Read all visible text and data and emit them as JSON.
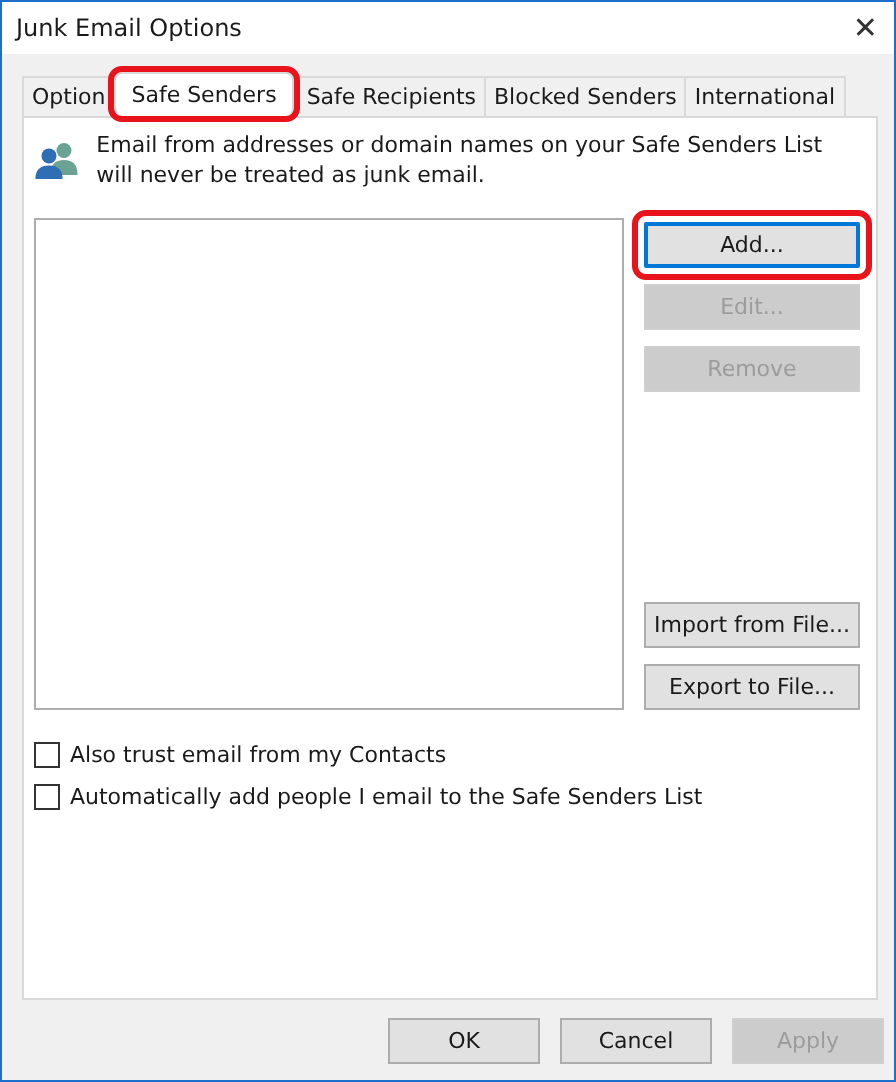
{
  "window": {
    "title": "Junk Email Options",
    "close": "✕"
  },
  "tabs": [
    {
      "label": "Option",
      "selected": false,
      "highlighted": false
    },
    {
      "label": "Safe Senders",
      "selected": true,
      "highlighted": true
    },
    {
      "label": "Safe Recipients",
      "selected": false,
      "highlighted": false
    },
    {
      "label": "Blocked Senders",
      "selected": false,
      "highlighted": false
    },
    {
      "label": "International",
      "selected": false,
      "highlighted": false
    }
  ],
  "description": "Email from addresses or domain names on your Safe Senders List will never be treated as junk email.",
  "list_buttons": [
    {
      "label": "Add...",
      "disabled": false,
      "highlighted": true
    },
    {
      "label": "Edit...",
      "disabled": true,
      "highlighted": false
    },
    {
      "label": "Remove",
      "disabled": true,
      "highlighted": false
    }
  ],
  "file_buttons": [
    {
      "label": "Import from File...",
      "disabled": false
    },
    {
      "label": "Export to File...",
      "disabled": false
    }
  ],
  "checkboxes": [
    {
      "label": "Also trust email from my Contacts",
      "checked": false
    },
    {
      "label": "Automatically add people I email to the Safe Senders List",
      "checked": false
    }
  ],
  "footer_buttons": [
    {
      "label": "OK",
      "disabled": false
    },
    {
      "label": "Cancel",
      "disabled": false
    },
    {
      "label": "Apply",
      "disabled": true
    }
  ]
}
